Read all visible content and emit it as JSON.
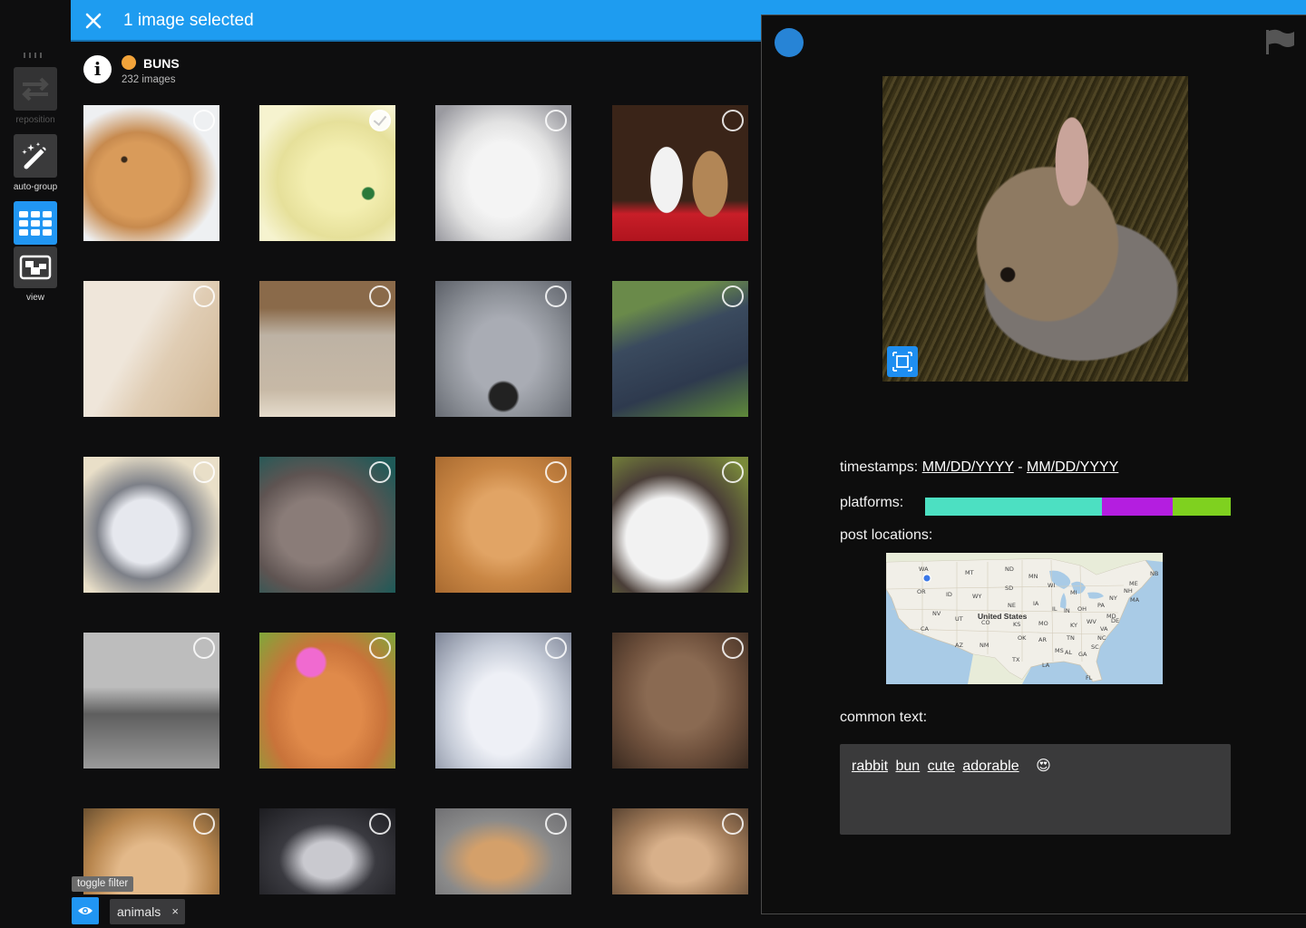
{
  "toolbar": {
    "reposition_label": "reposition",
    "autogroup_label": "auto-group",
    "view_label": "view"
  },
  "header": {
    "title": "1 image selected"
  },
  "group": {
    "name": "BUNS",
    "count": "232 images",
    "dot_color": "#f2a33a"
  },
  "grid": {
    "thumbnails": [
      {
        "selected": false
      },
      {
        "selected": true
      },
      {
        "selected": false
      },
      {
        "selected": false
      },
      {
        "selected": false
      },
      {
        "selected": false
      },
      {
        "selected": false
      },
      {
        "selected": false
      },
      {
        "selected": false
      },
      {
        "selected": false
      },
      {
        "selected": false
      },
      {
        "selected": false
      },
      {
        "selected": false
      },
      {
        "selected": false
      },
      {
        "selected": false
      },
      {
        "selected": false
      },
      {
        "selected": false
      },
      {
        "selected": false
      },
      {
        "selected": false
      },
      {
        "selected": false
      }
    ]
  },
  "filter": {
    "tooltip": "toggle filter",
    "tag_label": "animals",
    "tag_remove": "×"
  },
  "details": {
    "timestamps_label": "timestamps:",
    "timestamp_start": "MM/DD/YYYY",
    "timestamp_sep": "-",
    "timestamp_end": "MM/DD/YYYY",
    "platforms_label": "platforms:",
    "platforms": [
      {
        "share": 0.58,
        "color": "#4ce0c2"
      },
      {
        "share": 0.23,
        "color": "#b41ee0"
      },
      {
        "share": 0.19,
        "color": "#7fd11f"
      }
    ],
    "locations_label": "post locations:",
    "map": {
      "country": "United States",
      "states": [
        "WA",
        "MT",
        "ND",
        "MN",
        "OR",
        "ID",
        "SD",
        "WI",
        "MI",
        "WY",
        "NE",
        "IA",
        "IL",
        "IN",
        "OH",
        "PA",
        "NY",
        "NV",
        "UT",
        "CO",
        "KS",
        "MO",
        "KY",
        "WV",
        "VA",
        "CA",
        "AZ",
        "NM",
        "OK",
        "AR",
        "TN",
        "NC",
        "SC",
        "TX",
        "LA",
        "MS",
        "AL",
        "GA",
        "FL",
        "ME",
        "NH",
        "MA",
        "NB",
        "MD",
        "DE"
      ]
    },
    "common_text_label": "common text:",
    "common_words": [
      "rabbit",
      "bun",
      "cute",
      "adorable"
    ],
    "emoji": "😍"
  }
}
